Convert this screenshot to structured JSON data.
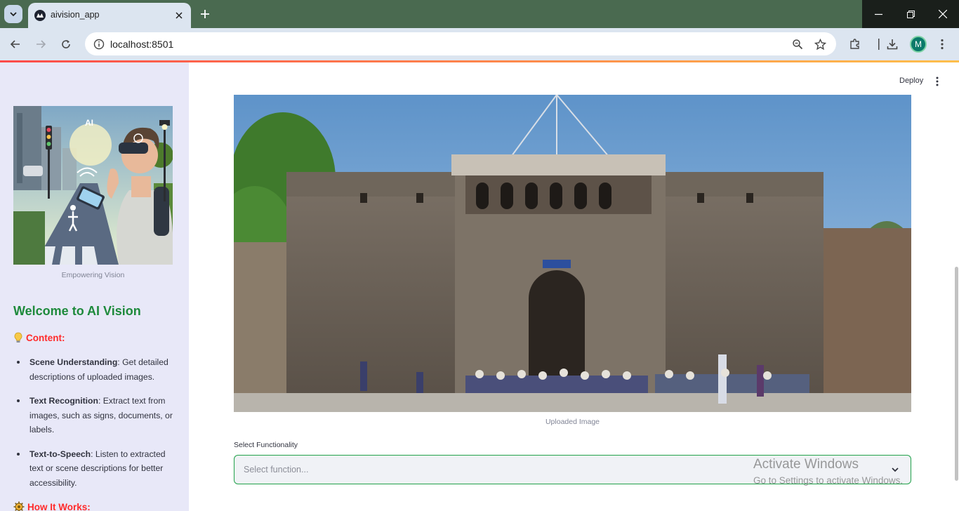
{
  "browser": {
    "tab_title": "aivision_app",
    "url": "localhost:8501",
    "profile_initial": "M"
  },
  "app": {
    "deploy_label": "Deploy"
  },
  "sidebar": {
    "image_caption": "Empowering Vision",
    "heading": "Welcome to AI Vision",
    "content_title": "Content:",
    "features": [
      {
        "name": "Scene Understanding",
        "desc": ": Get detailed descriptions of uploaded images."
      },
      {
        "name": "Text Recognition",
        "desc": ": Extract text from images, such as signs, documents, or labels."
      },
      {
        "name": "Text-to-Speech",
        "desc": ": Listen to extracted text or scene descriptions for better accessibility."
      }
    ],
    "how_title": "How It Works:"
  },
  "main": {
    "image_caption": "Uploaded Image",
    "select_label": "Select Functionality",
    "select_placeholder": "Select function..."
  },
  "watermark": {
    "line1": "Activate Windows",
    "line2": "Go to Settings to activate Windows."
  },
  "colors": {
    "accent_green": "#21a24a",
    "heading_green": "#1e8a3c",
    "section_red": "#ff2b2b",
    "sidebar_bg": "#e8e8f8"
  }
}
